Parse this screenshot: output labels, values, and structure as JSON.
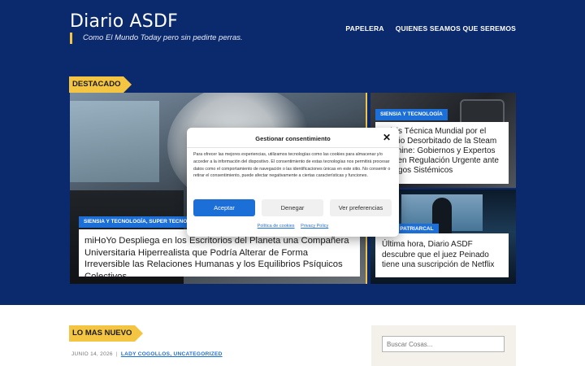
{
  "site": {
    "title": "Diario ASDF",
    "tagline": "Como El Mundo Today pero sin pedirte perras."
  },
  "nav": {
    "items": [
      "PAPELERA",
      "QUIENES SEAMOS QUE SEREMOS"
    ]
  },
  "featured": {
    "section_label": "DESTACADO",
    "main": {
      "categories": "SIENSIA Y TECNOLOGÍA, SUPER TECNO FAC",
      "headline": "miHoYo Despliega en los Escritorios del Planeta una Compañera Universitaria Hiperrealista que Podría Alterar de Forma Irreversible las Relaciones Humanas y los Equilibrios Psíquicos Colectivos"
    },
    "right_top": {
      "category": "SIENSIA Y TECNOLOGÍA",
      "headline": "Crisis Técnica Mundial por el Precio Desorbitado de la Steam Machine: Gobiernos y Expertos Exigen Regulación Urgente ante Riesgos Sistémicos"
    },
    "right_bottom": {
      "category": "LUCHA PATRIARCAL",
      "headline": "Última hora, Diario ASDF descubre que el juez Peinado tiene una suscripción de Netflix"
    }
  },
  "latest": {
    "section_label": "LO MAS NUEVO",
    "date": "JUNIO 14, 2026",
    "authors_categories": "LADY COGOLLOS, UNCATEGORIZED"
  },
  "sidebar": {
    "search_placeholder": "Buscar Cosas..."
  },
  "cookie_modal": {
    "title": "Gestionar consentimiento",
    "body": "Para ofrecer las mejores experiencias, utilizamos tecnologías como las cookies para almacenar y/o acceder a la información del dispositivo. El consentimiento de estas tecnologías nos permitirá procesar datos como el comportamiento de navegación o las identificaciones únicas en este sitio. No consentir o retirar el consentimiento, puede afectar negativamente a ciertas características y funciones.",
    "accept_label": "Aceptar",
    "deny_label": "Denegar",
    "prefs_label": "Ver preferencias",
    "cookie_policy_link": "Política de cookies",
    "privacy_link": "Privacy Policy"
  },
  "colors": {
    "header_bg": "#0b2a6e",
    "accent_yellow": "#f4c542",
    "accent_blue": "#1d6fd8"
  },
  "icons": [
    "close-icon"
  ]
}
